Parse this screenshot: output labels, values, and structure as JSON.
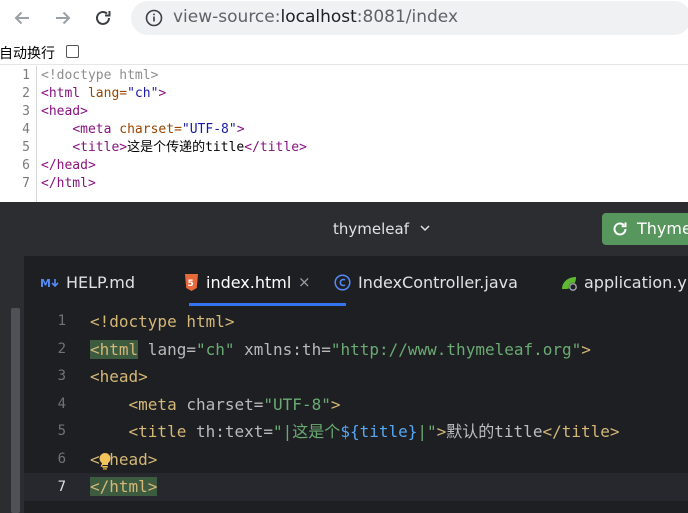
{
  "browser": {
    "url_prefix": "view-source:",
    "url_host": "localhost",
    "url_rest": ":8081/index"
  },
  "view_source": {
    "wrap_label": "自动换行",
    "wrap_checked": false,
    "lines": [
      {
        "num": "1",
        "comment": "<!doctype html>"
      },
      {
        "num": "2",
        "open": "<html ",
        "attr": "lang=",
        "val": "\"ch\"",
        "close": ">"
      },
      {
        "num": "3",
        "open": "<head>"
      },
      {
        "num": "4",
        "indent": "    ",
        "open": "<meta ",
        "attr": "charset=",
        "val": "\"UTF-8\"",
        "close": ">"
      },
      {
        "num": "5",
        "indent": "    ",
        "open": "<title>",
        "text": "这是个传递的title",
        "close": "</title>"
      },
      {
        "num": "6",
        "open": "</head>"
      },
      {
        "num": "7",
        "open": "</html>"
      }
    ]
  },
  "ide": {
    "project_name": "thymeleaf",
    "run_label": "Thyme",
    "colors": {
      "run_button": "#57965c",
      "active_tab": "#3574f0",
      "editor_bg": "#1e1f22"
    },
    "tabs": [
      {
        "label": "HELP.md",
        "icon": "markdown-icon"
      },
      {
        "label": "index.html",
        "icon": "html5-icon",
        "active": true,
        "close": "×"
      },
      {
        "label": "IndexController.java",
        "icon": "java-class-icon"
      },
      {
        "label": "application.yml",
        "icon": "spring-config-icon"
      }
    ],
    "gutter": [
      "1",
      "2",
      "3",
      "4",
      "5",
      "6",
      "7"
    ],
    "current_line": "7",
    "code": {
      "l1": {
        "tag": "<!doctype html>"
      },
      "l2": {
        "tag_open": "<html",
        "attr1": " lang=",
        "val1": "\"ch\"",
        "attr2": " xmlns:th=",
        "val2": "\"http://www.thymeleaf.org\"",
        "close": ">"
      },
      "l3": {
        "tag": "<head>"
      },
      "l4": {
        "indent": "    ",
        "tag_open": "<meta",
        "attr": " charset=",
        "val": "\"UTF-8\"",
        "close": ">"
      },
      "l5": {
        "indent": "    ",
        "tag_open": "<title",
        "attr": " th:text=",
        "q1": "\"|这是个",
        "expr": "${title}",
        "q2": "|\"",
        "close": ">",
        "text": "默认的title",
        "end": "</title>"
      },
      "l6": {
        "tag": "</head>"
      },
      "l7": {
        "tag": "</html>"
      }
    }
  }
}
